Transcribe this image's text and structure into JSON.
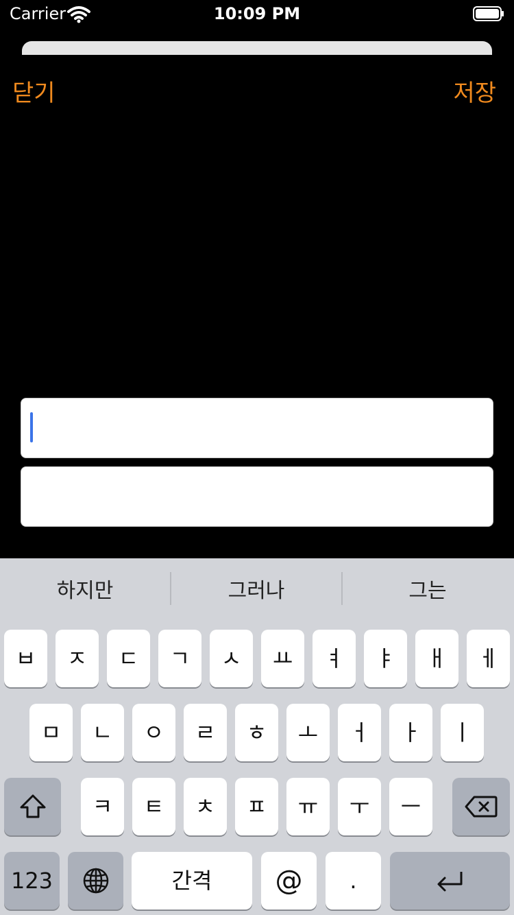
{
  "status_bar": {
    "carrier": "Carrier",
    "time": "10:09 PM"
  },
  "nav": {
    "close_label": "닫기",
    "save_label": "저장"
  },
  "colors": {
    "accent": "#f08a1e",
    "caret": "#3b74e8",
    "keyboard_bg": "#d2d4d9"
  },
  "keyboard": {
    "suggestions": [
      "하지만",
      "그러나",
      "그는"
    ],
    "row1": [
      "ㅂ",
      "ㅈ",
      "ㄷ",
      "ㄱ",
      "ㅅ",
      "ㅛ",
      "ㅕ",
      "ㅑ",
      "ㅐ",
      "ㅔ"
    ],
    "row2": [
      "ㅁ",
      "ㄴ",
      "ㅇ",
      "ㄹ",
      "ㅎ",
      "ㅗ",
      "ㅓ",
      "ㅏ",
      "ㅣ"
    ],
    "row3": [
      "ㅋ",
      "ㅌ",
      "ㅊ",
      "ㅍ",
      "ㅠ",
      "ㅜ",
      "ㅡ"
    ],
    "numbers_label": "123",
    "space_label": "간격",
    "at_label": "@",
    "period_label": "."
  }
}
